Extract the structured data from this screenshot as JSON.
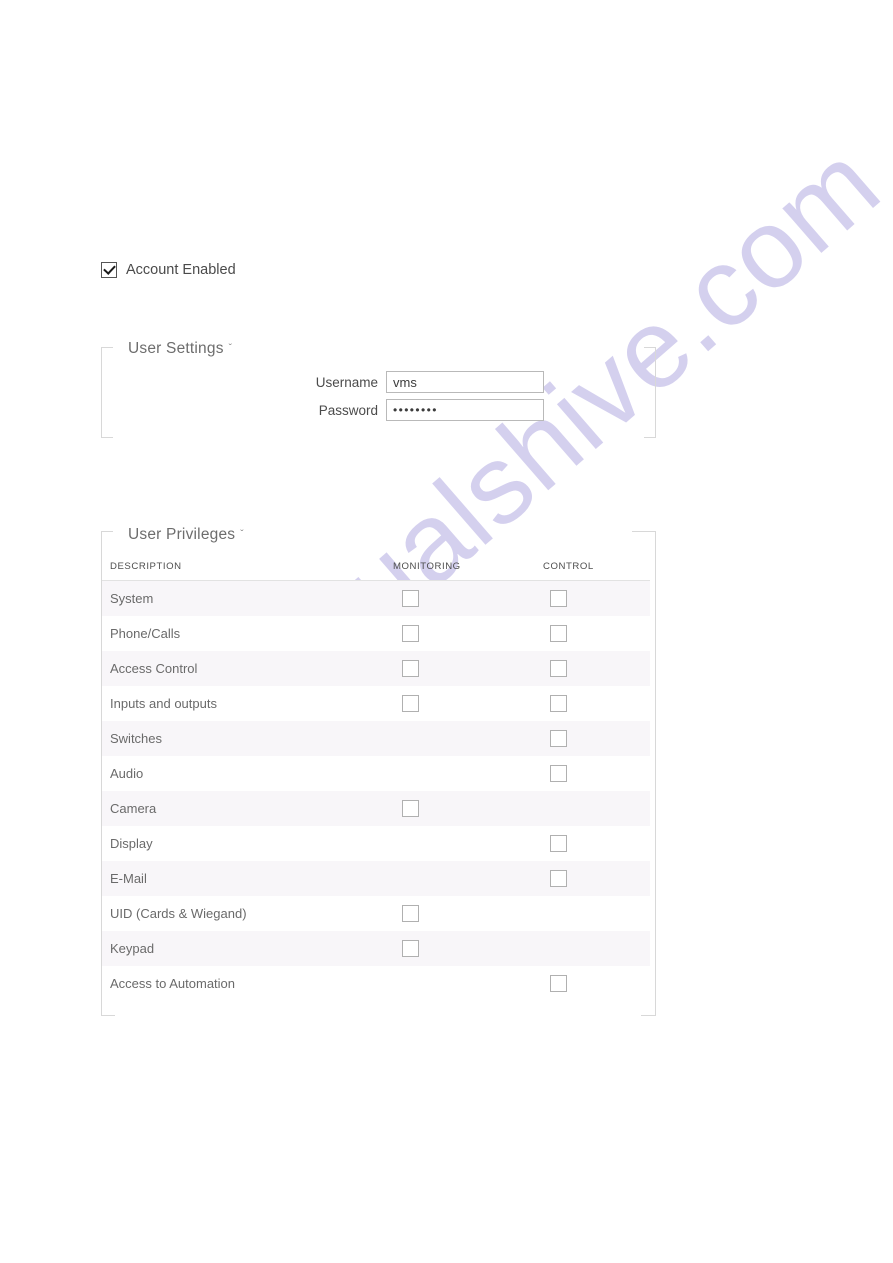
{
  "watermark": {
    "text": "manualshive.com",
    "color": "#c8c3ea"
  },
  "account": {
    "checkbox_label": "Account Enabled",
    "checked": true
  },
  "user_settings": {
    "title": "User Settings",
    "caret": "ˇ",
    "fields": [
      {
        "label": "Username",
        "value": "vms",
        "placeholder": "",
        "type": "text"
      },
      {
        "label": "Password",
        "value": "••••••••",
        "placeholder": "",
        "type": "password"
      }
    ]
  },
  "user_privileges": {
    "title": "User Privileges",
    "caret": "ˇ",
    "columns": [
      "DESCRIPTION",
      "MONITORING",
      "CONTROL"
    ],
    "rows": [
      {
        "description": "System",
        "monitoring": {
          "present": true,
          "checked": false
        },
        "control": {
          "present": true,
          "checked": false
        }
      },
      {
        "description": "Phone/Calls",
        "monitoring": {
          "present": true,
          "checked": false
        },
        "control": {
          "present": true,
          "checked": false
        }
      },
      {
        "description": "Access Control",
        "monitoring": {
          "present": true,
          "checked": false
        },
        "control": {
          "present": true,
          "checked": false
        }
      },
      {
        "description": "Inputs and outputs",
        "monitoring": {
          "present": true,
          "checked": false
        },
        "control": {
          "present": true,
          "checked": false
        }
      },
      {
        "description": "Switches",
        "monitoring": {
          "present": false,
          "checked": false
        },
        "control": {
          "present": true,
          "checked": false
        }
      },
      {
        "description": "Audio",
        "monitoring": {
          "present": false,
          "checked": false
        },
        "control": {
          "present": true,
          "checked": false
        }
      },
      {
        "description": "Camera",
        "monitoring": {
          "present": true,
          "checked": false
        },
        "control": {
          "present": false,
          "checked": false
        }
      },
      {
        "description": "Display",
        "monitoring": {
          "present": false,
          "checked": false
        },
        "control": {
          "present": true,
          "checked": false
        }
      },
      {
        "description": "E-Mail",
        "monitoring": {
          "present": false,
          "checked": false
        },
        "control": {
          "present": true,
          "checked": false
        }
      },
      {
        "description": "UID (Cards & Wiegand)",
        "monitoring": {
          "present": true,
          "checked": false
        },
        "control": {
          "present": false,
          "checked": false
        }
      },
      {
        "description": "Keypad",
        "monitoring": {
          "present": true,
          "checked": false
        },
        "control": {
          "present": false,
          "checked": false
        }
      },
      {
        "description": "Access to Automation",
        "monitoring": {
          "present": false,
          "checked": false
        },
        "control": {
          "present": true,
          "checked": false
        }
      }
    ]
  }
}
